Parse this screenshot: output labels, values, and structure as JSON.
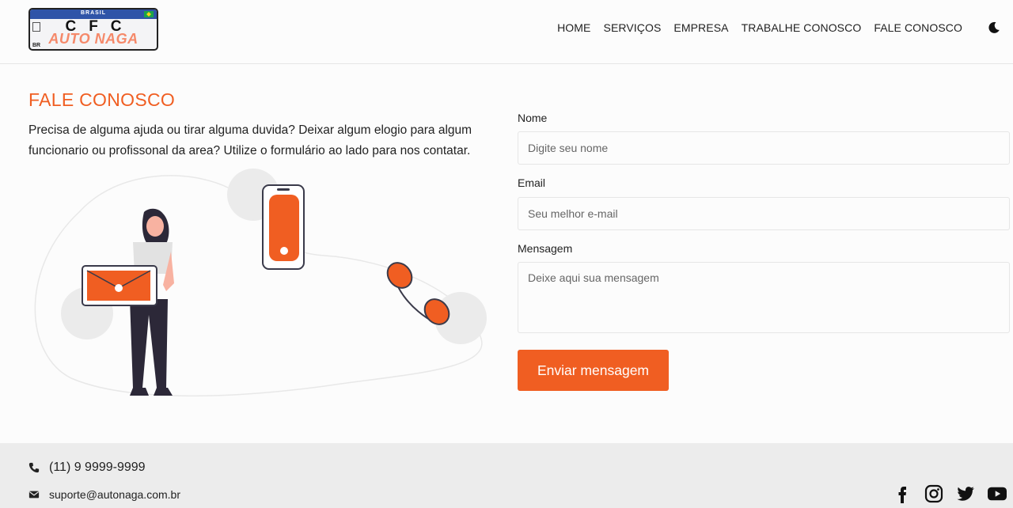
{
  "header": {
    "logo": {
      "country": "BRASIL",
      "text_top": "CFC",
      "text_bottom": "AUTO NAGA",
      "plate_code": "BR"
    },
    "nav": [
      {
        "label": "HOME"
      },
      {
        "label": "SERVIÇOS"
      },
      {
        "label": "EMPRESA"
      },
      {
        "label": "TRABALHE CONOSCO"
      },
      {
        "label": "FALE CONOSCO"
      }
    ],
    "theme_icon": "moon-icon"
  },
  "main": {
    "title": "FALE CONOSCO",
    "intro": "Precisa de alguma ajuda ou tirar alguma duvida? Deixar algum elogio para algum funcionario ou profissonal da area? Utilize o formulário ao lado para nos contatar."
  },
  "form": {
    "name_label": "Nome",
    "name_placeholder": "Digite seu nome",
    "email_label": "Email",
    "email_placeholder": "Seu melhor e-mail",
    "message_label": "Mensagem",
    "message_placeholder": "Deixe aqui sua mensagem",
    "submit_label": "Enviar mensagem"
  },
  "footer": {
    "phone": "(11) 9 9999-9999",
    "email": "suporte@autonaga.com.br",
    "socials": [
      "facebook-icon",
      "instagram-icon",
      "twitter-icon",
      "youtube-icon"
    ]
  },
  "colors": {
    "accent": "#f05e22",
    "background": "#fcfcfc",
    "footer": "#ececec"
  }
}
